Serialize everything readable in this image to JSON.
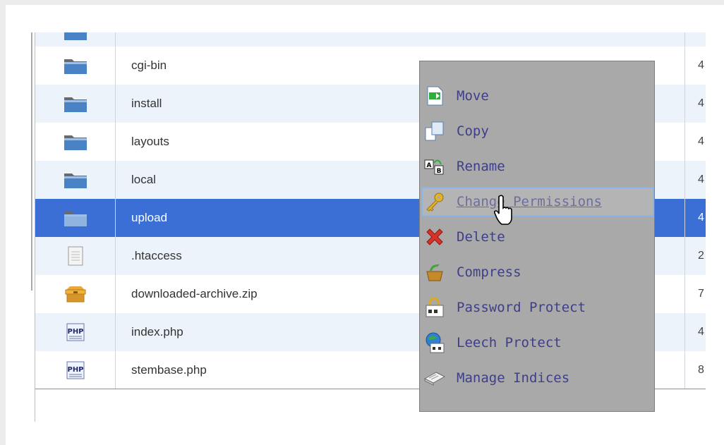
{
  "files": [
    {
      "name": "",
      "type": "folder",
      "size": ""
    },
    {
      "name": "cgi-bin",
      "type": "folder",
      "size": "4"
    },
    {
      "name": "install",
      "type": "folder",
      "size": "4"
    },
    {
      "name": "layouts",
      "type": "folder",
      "size": "4"
    },
    {
      "name": "local",
      "type": "folder",
      "size": "4"
    },
    {
      "name": "upload",
      "type": "folder",
      "size": "4",
      "selected": true
    },
    {
      "name": ".htaccess",
      "type": "text",
      "size": "2"
    },
    {
      "name": "downloaded-archive.zip",
      "type": "archive",
      "size": "7"
    },
    {
      "name": "index.php",
      "type": "php",
      "size": "4"
    },
    {
      "name": "stembase.php",
      "type": "php",
      "size": "8"
    }
  ],
  "context_menu": {
    "items": [
      {
        "label": "Move",
        "icon": "move-icon"
      },
      {
        "label": "Copy",
        "icon": "copy-icon"
      },
      {
        "label": "Rename",
        "icon": "rename-icon"
      },
      {
        "label": "Change Permissions",
        "icon": "key-icon",
        "hover": true
      },
      {
        "label": "Delete",
        "icon": "delete-icon"
      },
      {
        "label": "Compress",
        "icon": "compress-icon"
      },
      {
        "label": "Password Protect",
        "icon": "password-protect-icon"
      },
      {
        "label": "Leech Protect",
        "icon": "leech-protect-icon"
      },
      {
        "label": "Manage Indices",
        "icon": "manage-indices-icon"
      }
    ]
  },
  "colors": {
    "selected_row": "#3c6fd6",
    "alt_row": "#edf3fb",
    "menu_bg": "#a9a9a9",
    "menu_text": "#3e3e8a"
  }
}
